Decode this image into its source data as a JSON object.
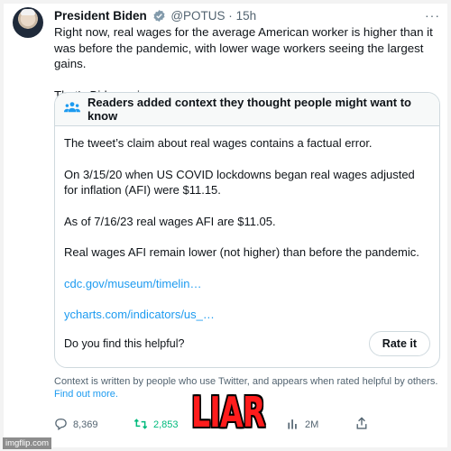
{
  "tweet": {
    "author_name": "President Biden",
    "handle": "@POTUS",
    "separator": "·",
    "time": "15h",
    "more": "···",
    "paragraphs": [
      "Right now, real wages for the average American worker is higher than it was before the pandemic, with lower wage workers seeing the largest gains.",
      "That's Bidenomics."
    ]
  },
  "community_notes": {
    "header": "Readers added context they thought people might want to know",
    "body": [
      "The tweet’s claim about real wages contains a factual error.",
      "On 3/15/20 when US COVID lockdowns began real wages adjusted for inflation (AFI) were $11.15.",
      "As of 7/16/23 real wages AFI are $11.05.",
      "Real wages AFI remain lower (not higher) than before the pandemic."
    ],
    "links": [
      "cdc.gov/museum/timelin…",
      "ycharts.com/indicators/us_…"
    ],
    "helpful_question": "Do you find this helpful?",
    "rate_button": "Rate it"
  },
  "context_footer": {
    "text": "Context is written by people who use Twitter, and appears when rated helpful by others.",
    "link": "Find out more."
  },
  "actions": {
    "replies": "8,369",
    "retweets": "2,853",
    "views": "2M"
  },
  "overlay_caption": "LIAR",
  "watermark": "imgflip.com",
  "colors": {
    "link_blue": "#1d9bf0",
    "retweet_green": "#00ba7c",
    "caption_red": "#ff1c1c",
    "muted_gray": "#536471"
  }
}
